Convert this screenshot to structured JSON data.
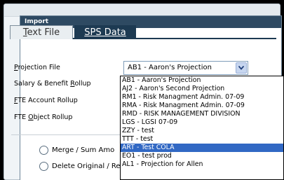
{
  "panel": {
    "title": "Import"
  },
  "tabs": [
    {
      "prefix": "T",
      "rest": "ext File"
    },
    {
      "prefix": "S",
      "rest": "PS Data"
    }
  ],
  "form": {
    "projection_label_prefix": "P",
    "projection_label_rest": "rojection File",
    "salary_label_prefix": "Salary & Benefit ",
    "salary_label_mid": "R",
    "salary_label_rest": "ollup",
    "fte_account_prefix": "F",
    "fte_account_rest": "TE Account Rollup",
    "fte_object_prefix": "FTE ",
    "fte_object_mid": "O",
    "fte_object_rest": "bject Rollup",
    "selected_projection": "AB1 - Aaron's Projection"
  },
  "dropdown": {
    "options": [
      "AB1 - Aaron's Projection",
      "AJ2 - Aaron's Second Projection",
      "RM1 - Risk Managment Admin. 07-09",
      "RMA - Risk Managment Admin. 07-09",
      "RMD - RISK MANAGEMENT DIVISION",
      "LGS - LGSI 07-09",
      "ZZY - test",
      "TTT - test",
      "ART - Test COLA",
      "EO1 - test prod",
      "AL1 - Projection for Allen"
    ],
    "highlighted": "ART - Test COLA"
  },
  "options": {
    "merge_label": "Merge / Sum Amo",
    "delete_label": "Delete Original / Re"
  },
  "colors": {
    "header_bg": "#2e4a62",
    "active_tab": "#1d3a52",
    "highlight": "#3168c4"
  }
}
